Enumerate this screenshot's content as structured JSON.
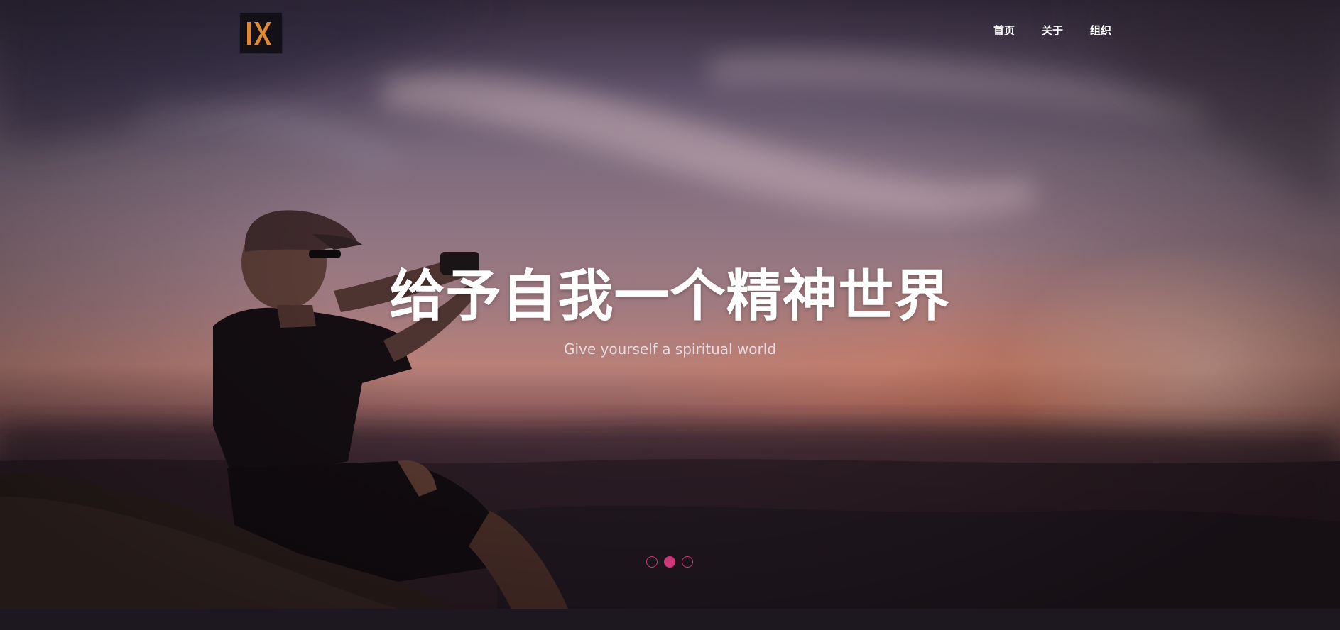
{
  "header": {
    "logo_text": "IX",
    "nav": [
      {
        "label": "首页"
      },
      {
        "label": "关于"
      },
      {
        "label": "组织"
      }
    ]
  },
  "hero": {
    "title": "给予自我一个精神世界",
    "subtitle": "Give yourself a spiritual world",
    "carousel": {
      "count": 3,
      "active_index": 1
    }
  },
  "colors": {
    "accent": "#d0377a",
    "logo_orange": "#e08a2e",
    "footer_bg": "#1d1720"
  }
}
